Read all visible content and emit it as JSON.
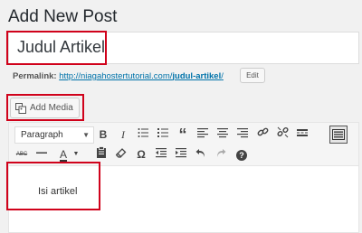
{
  "page": {
    "title": "Add New Post"
  },
  "post": {
    "title_value": "Judul Artikel",
    "permalink_label": "Permalink:",
    "permalink_base": "http://niagahostertutorial.com/",
    "permalink_slug": "judul-artikel",
    "permalink_trail": "/",
    "edit_label": "Edit"
  },
  "media": {
    "add_media_label": "Add Media"
  },
  "toolbar": {
    "format_selected": "Paragraph",
    "row1_icons": [
      "bold-icon",
      "italic-icon",
      "bullet-list-icon",
      "numbered-list-icon",
      "blockquote-icon",
      "align-left-icon",
      "align-center-icon",
      "align-right-icon",
      "link-icon",
      "unlink-icon",
      "read-more-icon",
      "toolbar-toggle-icon"
    ],
    "row2_icons": [
      "strikethrough-icon",
      "horizontal-line-icon",
      "text-color-icon",
      "paste-text-icon",
      "clear-formatting-icon",
      "special-character-icon",
      "outdent-icon",
      "indent-icon",
      "undo-icon",
      "redo-icon",
      "help-icon"
    ],
    "glyphs": {
      "bold": "B",
      "italic": "I",
      "quote": "“",
      "omega": "Ω",
      "help": "?",
      "strike": "ABC",
      "text_color": "A"
    }
  },
  "editor": {
    "content": "Isi artikel"
  },
  "colors": {
    "highlight_border": "#d0021b",
    "link": "#0073aa",
    "background": "#f1f1f1"
  }
}
